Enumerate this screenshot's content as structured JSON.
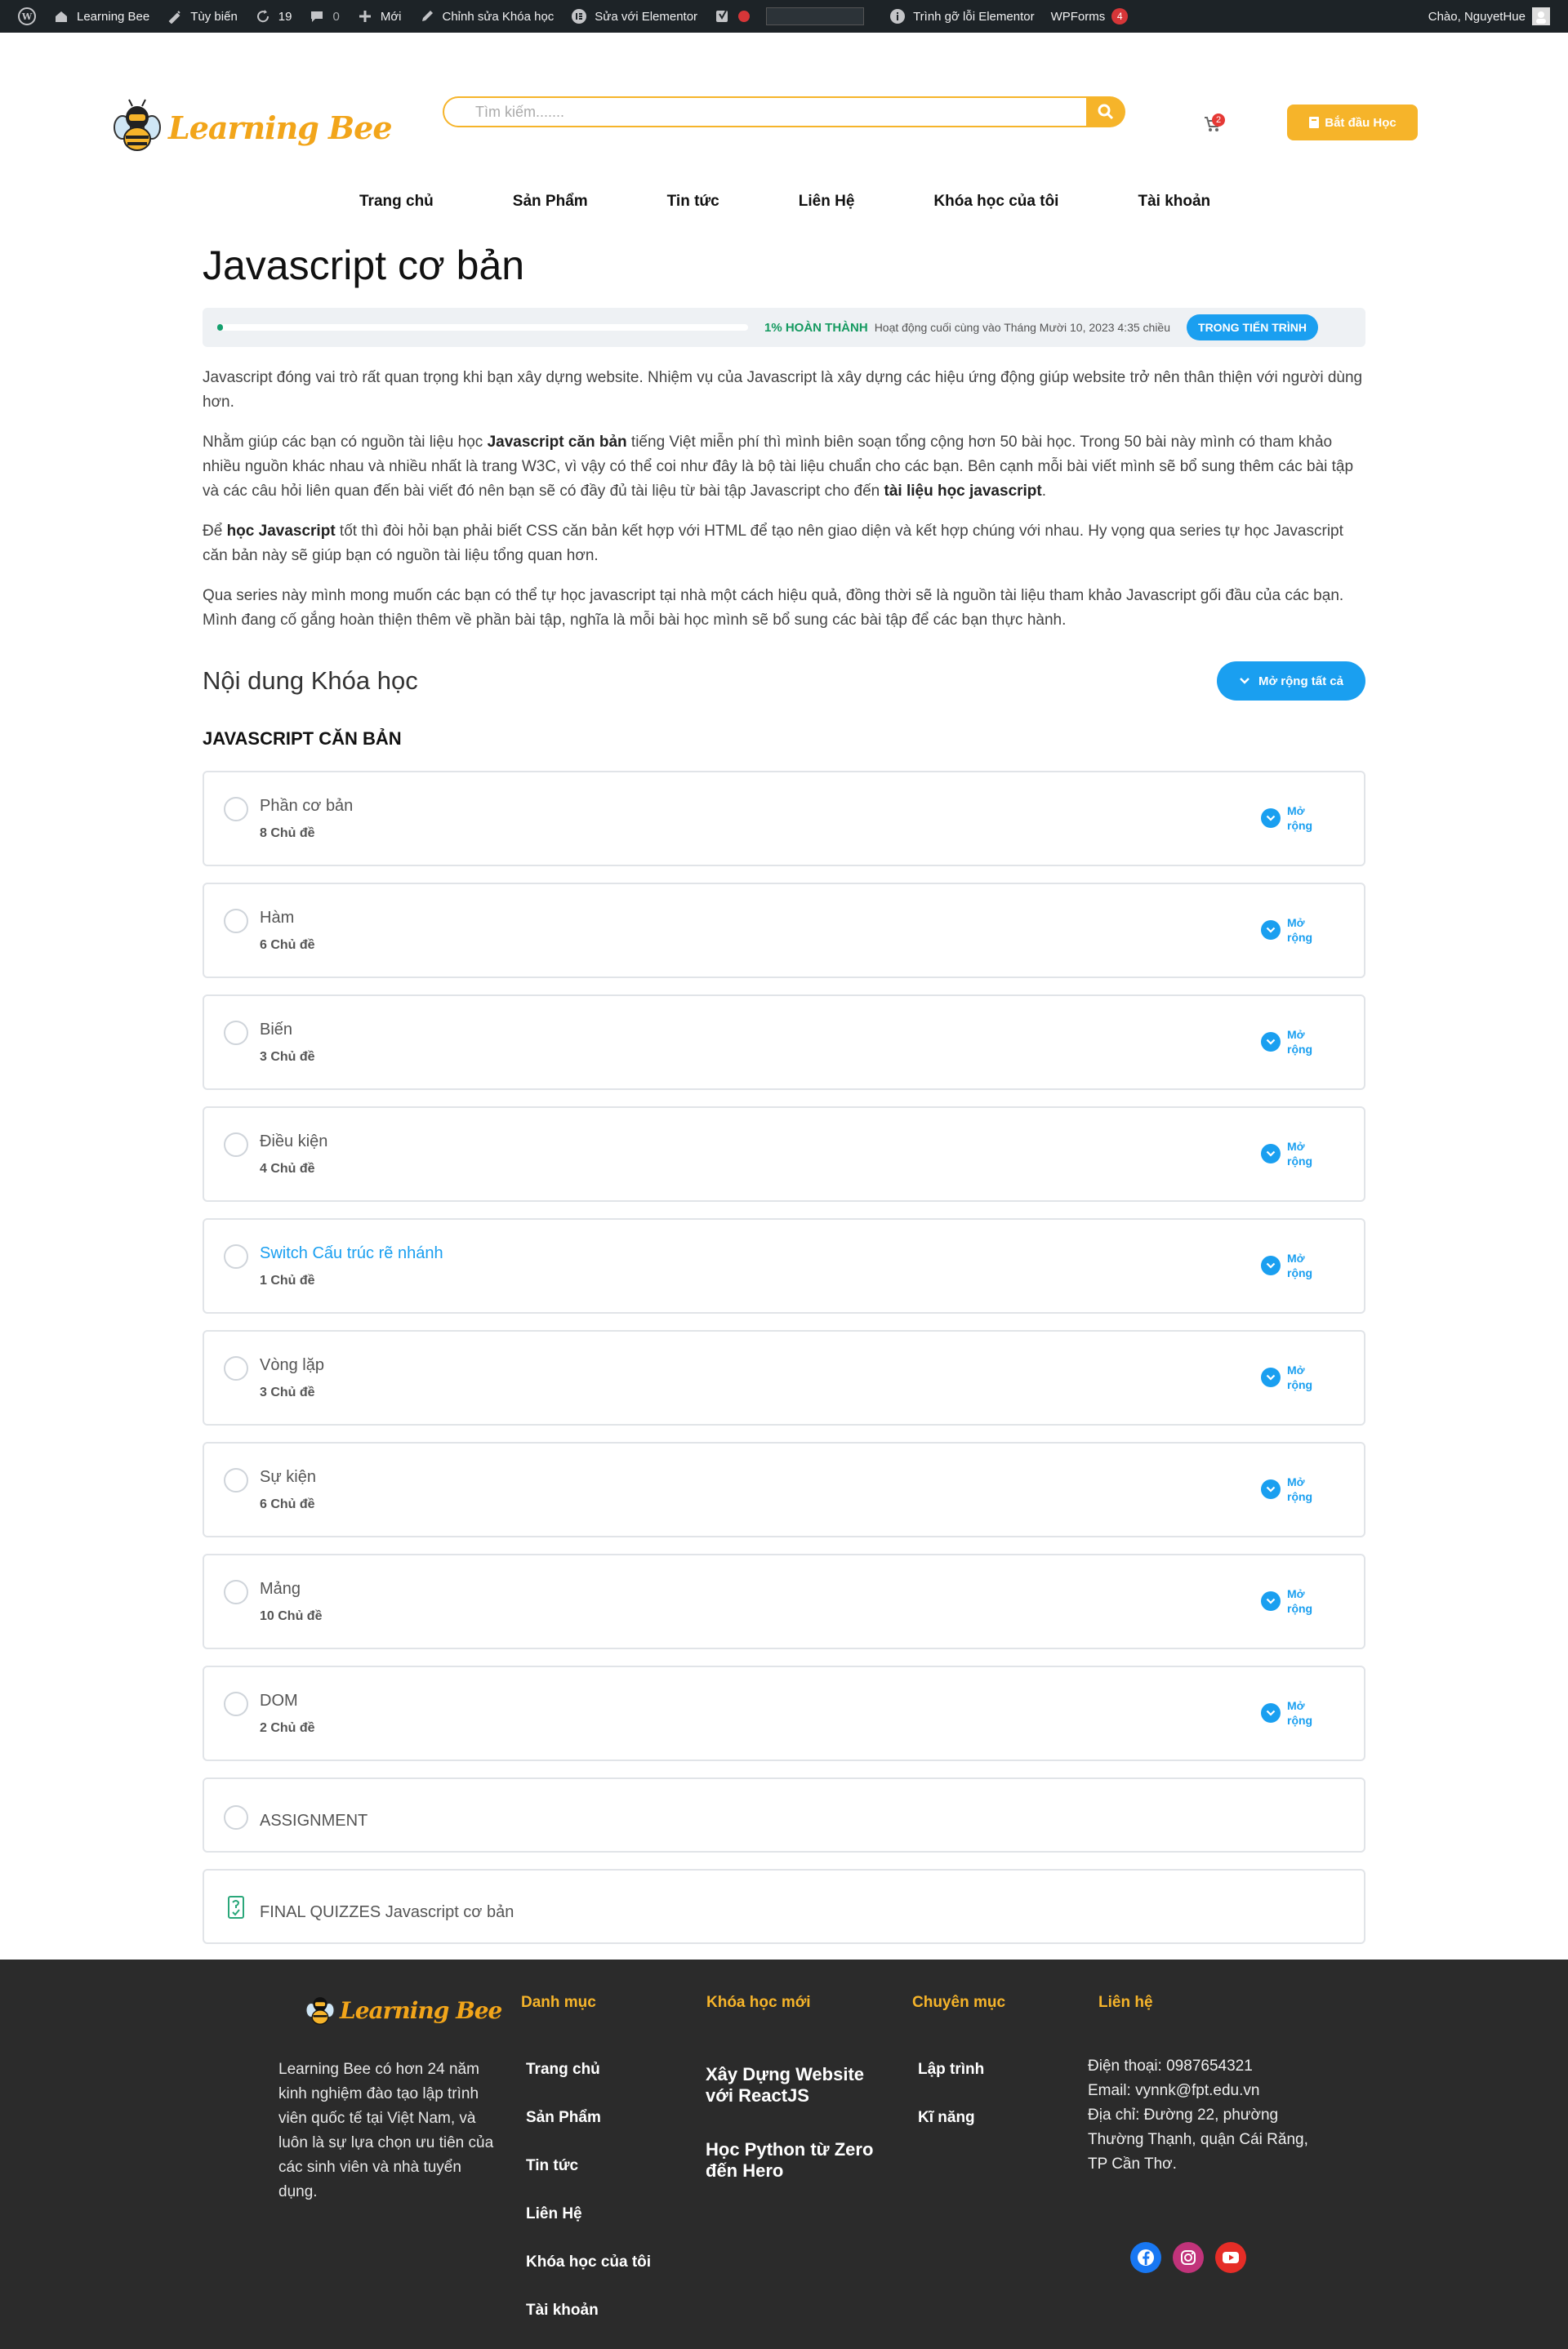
{
  "adminbar": {
    "site_name": "Learning Bee",
    "customize": "Tùy biến",
    "updates_count": "19",
    "comments_count": "0",
    "new": "Mới",
    "edit_course": "Chỉnh sửa Khóa học",
    "edit_elementor": "Sửa với Elementor",
    "debugger": "Trình gỡ lỗi Elementor",
    "wpforms": "WPForms",
    "wpforms_count": "4",
    "greeting": "Chào, NguyetHue"
  },
  "header": {
    "logo_text": "Learning Bee",
    "search_placeholder": "Tìm kiếm.......",
    "cart_count": "2",
    "start_button": "Bắt đầu Học"
  },
  "nav": {
    "items": [
      "Trang chủ",
      "Sản Phẩm",
      "Tin tức",
      "Liên Hệ",
      "Khóa học của tôi",
      "Tài khoản"
    ]
  },
  "course": {
    "title": "Javascript cơ bản",
    "progress": {
      "percent": 1,
      "label": "1% HOÀN THÀNH",
      "last_activity": "Hoạt động cuối cùng vào Tháng Mười 10, 2023 4:35 chiều",
      "status": "TRONG TIẾN TRÌNH"
    },
    "desc": {
      "p1": "Javascript đóng vai trò rất quan trọng khi bạn xây dựng website. Nhiệm vụ của Javascript là xây dựng các hiệu ứng động giúp website trở nên thân thiện với người dùng hơn.",
      "p2_a": "Nhằm giúp các bạn có nguồn tài liệu học ",
      "p2_b": "Javascript căn bản",
      "p2_c": " tiếng Việt miễn phí thì mình biên soạn tổng cộng hơn 50 bài học. Trong 50 bài này mình có tham khảo nhiều nguồn khác nhau và nhiều nhất là trang W3C, vì vậy có thể coi như đây là bộ tài liệu chuẩn cho các bạn. Bên cạnh mỗi bài viết mình sẽ bổ sung thêm các bài tập và các câu hỏi liên quan đến bài viết đó nên bạn sẽ có đầy đủ tài liệu từ bài tập Javascript cho đến ",
      "p2_d": "tài liệu học javascript",
      "p2_e": ".",
      "p3_a": "Để ",
      "p3_b": "học Javascript",
      "p3_c": " tốt thì đòi hỏi bạn phải biết CSS căn bản kết hợp với HTML để tạo nên giao diện và kết hợp chúng với nhau. Hy vọng qua series tự học Javascript căn bản này sẽ giúp bạn có nguồn tài liệu tổng quan hơn.",
      "p4": "Qua series này mình mong muốn các bạn có thể tự học javascript tại nhà một cách hiệu quả, đồng thời sẽ là nguồn tài liệu tham khảo Javascript gối đầu của các bạn. Mình đang cố gắng hoàn thiện thêm về phần bài tập, nghĩa là mỗi bài học mình sẽ bổ sung các bài tập để các bạn thực hành."
    },
    "content_heading": "Nội dung Khóa học",
    "expand_all": "Mở rộng tất cả",
    "group": "JAVASCRIPT CĂN BẢN",
    "expand_label_1": "Mở",
    "expand_label_2": "rộng",
    "lessons": [
      {
        "name": "Phần cơ bản",
        "count": "8 Chủ đề"
      },
      {
        "name": "Hàm",
        "count": "6 Chủ đề"
      },
      {
        "name": "Biến",
        "count": "3 Chủ đề"
      },
      {
        "name": "Điều kiện",
        "count": "4 Chủ đề"
      },
      {
        "name": "Switch Cấu trúc rẽ nhánh",
        "count": "1 Chủ đề"
      },
      {
        "name": "Vòng lặp",
        "count": "3 Chủ đề"
      },
      {
        "name": "Sự kiện",
        "count": "6 Chủ đề"
      },
      {
        "name": "Mảng",
        "count": "10 Chủ đề"
      },
      {
        "name": "DOM",
        "count": "2 Chủ đề"
      }
    ],
    "assignment": "ASSIGNMENT",
    "final_quiz": "FINAL QUIZZES Javascript cơ bản"
  },
  "footer": {
    "logo_text": "Learning Bee",
    "about": "Learning Bee có hơn 24 năm kinh nghiệm đào tạo lập trình viên quốc tế tại Việt Nam, và luôn là sự lựa chọn ưu tiên của các sinh viên và nhà tuyển dụng.",
    "danh_muc": "Danh mục",
    "danh_muc_items": [
      "Trang chủ",
      "Sản Phẩm",
      "Tin tức",
      "Liên Hệ",
      "Khóa học của tôi",
      "Tài khoản"
    ],
    "khoa_hoc_moi": "Khóa học mới",
    "courses": [
      "Xây Dựng Website với ReactJS",
      "Học Python từ Zero đến Hero"
    ],
    "chuyen_muc": "Chuyên mục",
    "chuyen_muc_items": [
      "Lập trình",
      "Kĩ năng"
    ],
    "lien_he": "Liên hệ",
    "phone": "Điện thoại: 0987654321",
    "email": "Email: vynnk@fpt.edu.vn",
    "address": "Địa chỉ: Đường 22, phường Thường Thạnh, quận Cái Răng, TP Cần Thơ."
  },
  "colors": {
    "accent": "#f6b42a",
    "primary_blue": "#1a9ff0",
    "footer_bg": "#2b2b2b",
    "progress_green": "#15a06e"
  },
  "icons": [
    "wordpress-icon",
    "home-icon",
    "brush-icon",
    "refresh-icon",
    "comment-icon",
    "plus-icon",
    "pencil-icon",
    "elementor-icon",
    "yoast-icon",
    "info-icon",
    "search-icon",
    "cart-icon",
    "chevron-down-icon",
    "quiz-icon",
    "facebook-icon",
    "instagram-icon",
    "youtube-icon"
  ]
}
